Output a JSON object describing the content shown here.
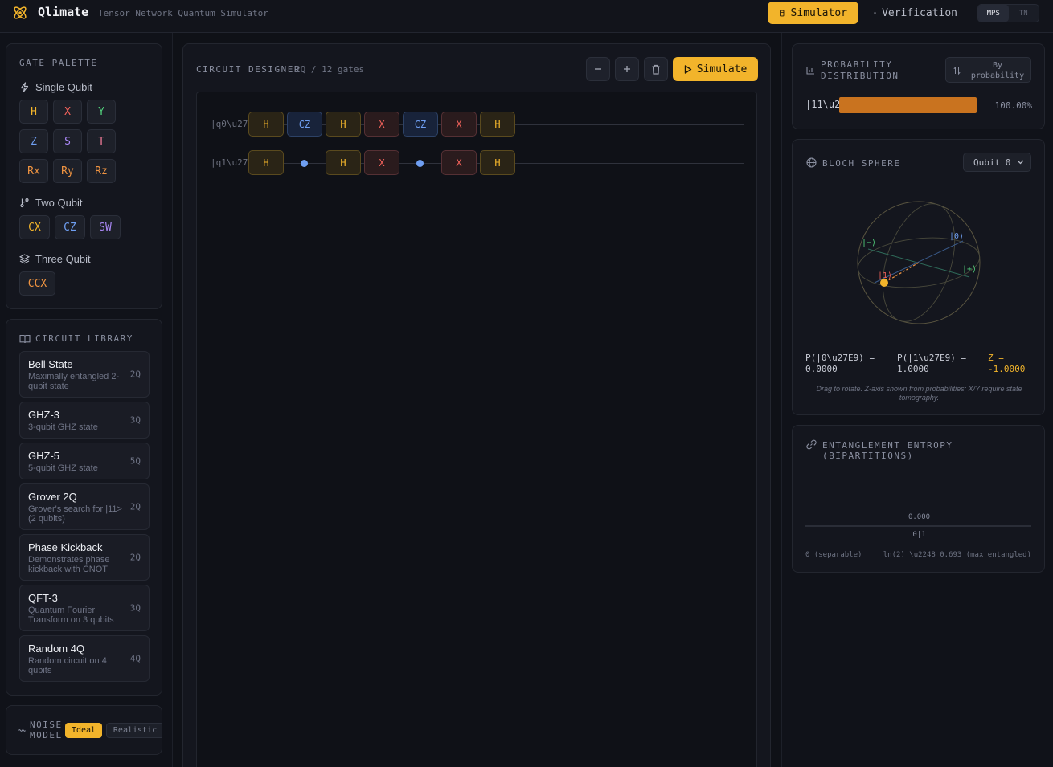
{
  "app": {
    "name": "Qlimate",
    "subtitle": "Tensor Network Quantum Simulator"
  },
  "nav": {
    "simulator": "Simulator",
    "verification": "Verification",
    "modes": [
      "MPS",
      "TN"
    ],
    "active_mode": "MPS"
  },
  "gate_palette": {
    "title": "GATE PALETTE",
    "single_title": "Single Qubit",
    "single": [
      "H",
      "X",
      "Y",
      "Z",
      "S",
      "T",
      "Rx",
      "Ry",
      "Rz"
    ],
    "two_title": "Two Qubit",
    "two": [
      "CX",
      "CZ",
      "SW"
    ],
    "three_title": "Three Qubit",
    "three": [
      "CCX"
    ]
  },
  "library": {
    "title": "CIRCUIT LIBRARY",
    "items": [
      {
        "name": "Bell State",
        "desc": "Maximally entangled 2-qubit state",
        "qubits": "2Q"
      },
      {
        "name": "GHZ-3",
        "desc": "3-qubit GHZ state",
        "qubits": "3Q"
      },
      {
        "name": "GHZ-5",
        "desc": "5-qubit GHZ state",
        "qubits": "5Q"
      },
      {
        "name": "Grover 2Q",
        "desc": "Grover's search for |11> (2 qubits)",
        "qubits": "2Q"
      },
      {
        "name": "Phase Kickback",
        "desc": "Demonstrates phase kickback with CNOT",
        "qubits": "2Q"
      },
      {
        "name": "QFT-3",
        "desc": "Quantum Fourier Transform on 3 qubits",
        "qubits": "3Q"
      },
      {
        "name": "Random 4Q",
        "desc": "Random circuit on 4 qubits",
        "qubits": "4Q"
      }
    ]
  },
  "noise": {
    "title_line1": "NOISE",
    "title_line2": "MODEL",
    "options": [
      "Ideal",
      "Realistic"
    ],
    "active": "Ideal"
  },
  "designer": {
    "title": "CIRCUIT DESIGNER",
    "stats": "2Q / 12 gates",
    "simulate": "Simulate",
    "qubit_labels": [
      "|q0\\u27E9",
      "|q1\\u27E9"
    ],
    "q0_gates": [
      "H",
      "CZ",
      "H",
      "X",
      "CZ",
      "X",
      "H"
    ],
    "q1_gates": [
      "H",
      "",
      "H",
      "X",
      "",
      "X",
      "H"
    ]
  },
  "probability": {
    "title_line1": "PROBABILITY",
    "title_line2": "DISTRIBUTION",
    "sort_line1": "By",
    "sort_line2": "probability",
    "rows": [
      {
        "state": "|11\\u2",
        "percent": "100.00%",
        "value": 1.0
      }
    ],
    "bar_color": "#c9731f"
  },
  "bloch": {
    "title": "BLOCH SPHERE",
    "select": "Qubit 0",
    "labels": {
      "zero": "|0⟩",
      "one": "|1⟩",
      "plus": "|+⟩",
      "minus": "|−⟩"
    },
    "p0": "P(|0\\u27E9) =",
    "p0_val": "0.0000",
    "p1": "P(|1\\u27E9) =",
    "p1_val": "1.0000",
    "z": "Z =",
    "z_val": "-1.0000",
    "note": "Drag to rotate. Z-axis shown from probabilities; X/Y require state tomography."
  },
  "entropy": {
    "title": "ENTANGLEMENT ENTROPY (BIPARTITIONS)",
    "value": "0.000",
    "partition": "0|1",
    "min_label": "0 (separable)",
    "max_label": "ln(2) \\u2248 0.693 (max entangled)"
  }
}
